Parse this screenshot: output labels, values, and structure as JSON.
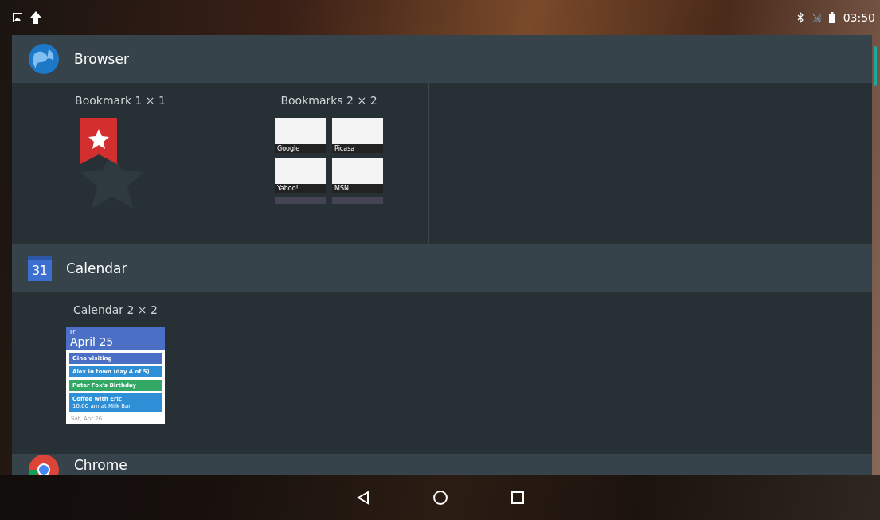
{
  "status_bar": {
    "time": "03:50"
  },
  "apps": [
    {
      "name": "Browser",
      "widgets": [
        {
          "kind": "bookmark",
          "label": "Bookmark 1 × 1"
        },
        {
          "kind": "bookmarks",
          "label": "Bookmarks 2 × 2",
          "tiles": [
            "Google",
            "Picasa",
            "Yahoo!",
            "MSN"
          ]
        }
      ]
    },
    {
      "name": "Calendar",
      "icon_text": "31",
      "widgets": [
        {
          "kind": "calendar",
          "label": "Calendar 2 × 2",
          "day": "Fri",
          "date": "April 25",
          "events": [
            {
              "title": "Gina visiting",
              "color": "#4a6fc4"
            },
            {
              "title": "Alex in town (day 4 of 5)",
              "color": "#2e8fd6"
            },
            {
              "title": "Peter Fox's Birthday",
              "color": "#33a866"
            },
            {
              "title": "Coffee with Eric",
              "detail": "10:00 am at Milk Bar",
              "color": "#2e8fd6"
            }
          ],
          "next_day": "Sat, Apr 26"
        }
      ]
    },
    {
      "name": "Chrome"
    }
  ]
}
